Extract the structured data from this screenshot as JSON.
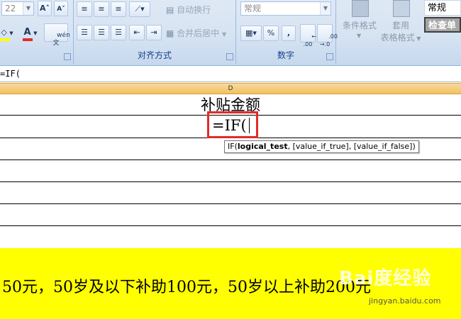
{
  "ribbon": {
    "font": {
      "size_value": "22",
      "grow_font_label": "A˄",
      "shrink_font_label": "A˅",
      "fill_color_label": "◇",
      "font_color_label": "A",
      "phonetic_label": "wén\n文"
    },
    "alignment": {
      "group_label": "对齐方式",
      "wrap_text_label": "自动换行",
      "merge_center_label": "合并后居中"
    },
    "number": {
      "group_label": "数字",
      "format_value": "常规",
      "percent_label": "%",
      "comma_label": ",",
      "increase_decimal_label": "←.0\n.00",
      "decrease_decimal_label": ".00\n→.0"
    },
    "styles": {
      "conditional_format_label": "条件格式",
      "table_format_line1": "套用",
      "table_format_line2": "表格格式",
      "style_normal": "常规",
      "style_check": "检查单"
    }
  },
  "formula_bar": {
    "content": "=IF("
  },
  "column_header": {
    "label": "D"
  },
  "sheet": {
    "header_cell": "补贴金额",
    "formula_cell": "=IF(",
    "tooltip": {
      "func": "IF(",
      "arg1": "logical_test",
      "rest": ", [value_if_true], [value_if_false])"
    }
  },
  "note": {
    "text": "50元，50岁及以下补助100元，50岁以上补助200元"
  },
  "watermark": {
    "brand": "Bai度经验",
    "url": "jingyan.baidu.com"
  },
  "colors": {
    "highlight_border": "#e32a2a",
    "note_background": "#ffff00",
    "column_header": "#f1c15f"
  }
}
